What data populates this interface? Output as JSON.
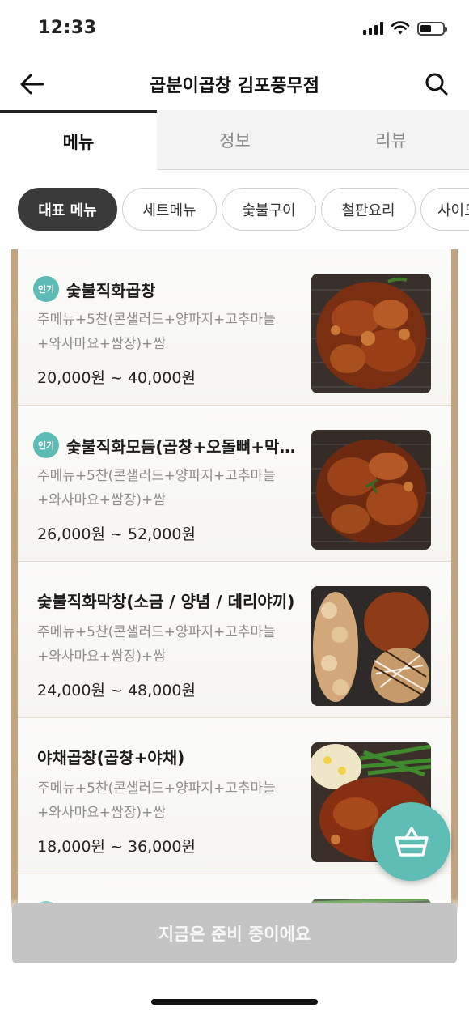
{
  "status": {
    "time": "12:33"
  },
  "header": {
    "title": "곱분이곱창 김포풍무점"
  },
  "tabs": [
    {
      "label": "메뉴"
    },
    {
      "label": "정보"
    },
    {
      "label": "리뷰"
    }
  ],
  "chips": [
    {
      "label": "대표 메뉴"
    },
    {
      "label": "세트메뉴"
    },
    {
      "label": "숯불구이"
    },
    {
      "label": "철판요리"
    },
    {
      "label": "사이드"
    }
  ],
  "menu_items": [
    {
      "badge": "인기",
      "name": "숯불직화곱창",
      "desc": "주메뉴+5찬(콘샐러드+양파지+고추마늘+와사마요+쌈장)+쌈",
      "price": "20,000원 ~ 40,000원"
    },
    {
      "badge": "인기",
      "name": "숯불직화모듬(곱창+오돌뼈+막창)",
      "desc": "주메뉴+5찬(콘샐러드+양파지+고추마늘+와사마요+쌈장)+쌈",
      "price": "26,000원 ~ 52,000원"
    },
    {
      "badge": "",
      "name": "숯불직화막창(소금 / 양념 / 데리야끼)",
      "desc": "주메뉴+5찬(콘샐러드+양파지+고추마늘+와사마요+쌈장)+쌈",
      "price": "24,000원 ~ 48,000원"
    },
    {
      "badge": "",
      "name": "야채곱창(곱창+야채)",
      "desc": "주메뉴+5찬(콘샐러드+양파지+고추마늘+와사마요+쌈장)+쌈",
      "price": "18,000원 ~ 36,000원"
    }
  ],
  "bottom": {
    "order_label": "지금은 준비 중이에요"
  },
  "colors": {
    "accent": "#5ebdb5",
    "frame": "#c4a47c",
    "disabled": "#c4c4c4",
    "active_chip": "#3a3a3a"
  }
}
